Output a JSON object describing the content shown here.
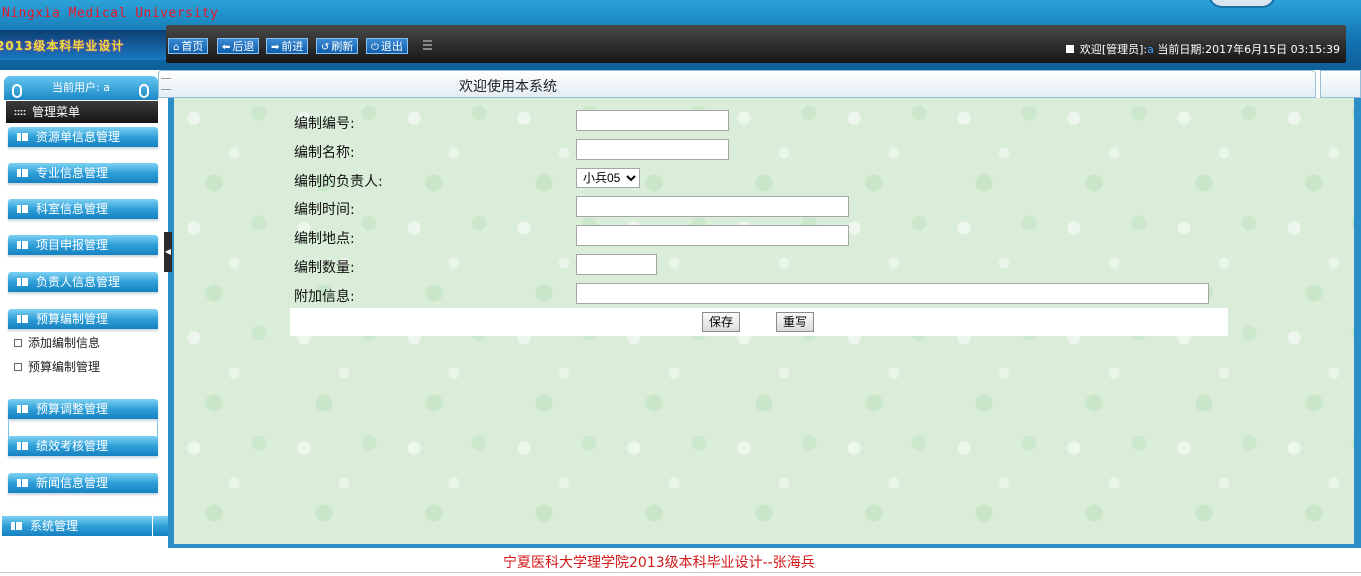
{
  "header": {
    "brand": "Ningxia Medical University",
    "banner_text": "2013级本科毕业设计",
    "toolbar": [
      {
        "icon": "home-icon",
        "glyph": "⌂",
        "label": "首页"
      },
      {
        "icon": "back-arrow-icon",
        "glyph": "⬅",
        "label": "后退"
      },
      {
        "icon": "forward-arrow-icon",
        "glyph": "➡",
        "label": "前进"
      },
      {
        "icon": "refresh-icon",
        "glyph": "↺",
        "label": "刷新"
      },
      {
        "icon": "power-icon",
        "glyph": "⏻",
        "label": "退出"
      }
    ],
    "welcome_prefix": "欢迎[管理员]:",
    "welcome_user": "a",
    "date_label": "当前日期:",
    "date_value": "2017年6月15日 03:15:39"
  },
  "sidebar": {
    "current_user": "当前用户: a",
    "menu_title": "管理菜单",
    "items": [
      {
        "label": "资源单信息管理"
      },
      {
        "label": "专业信息管理"
      },
      {
        "label": "科室信息管理"
      },
      {
        "label": "项目申报管理"
      },
      {
        "label": "负责人信息管理"
      },
      {
        "label": "预算编制管理"
      },
      {
        "label": "预算调整管理"
      },
      {
        "label": "绩效考核管理"
      },
      {
        "label": "新闻信息管理"
      }
    ],
    "subitems": [
      {
        "label": "添加编制信息"
      },
      {
        "label": "预算编制管理"
      }
    ],
    "system": {
      "label": "系统管理"
    }
  },
  "main": {
    "welcome_title": "欢迎使用本系统",
    "form": {
      "code_label": "编制编号:",
      "code_value": "",
      "name_label": "编制名称:",
      "name_value": "",
      "owner_label": "编制的负责人:",
      "owner_selected": "小兵05",
      "time_label": "编制时间:",
      "time_value": "",
      "place_label": "编制地点:",
      "place_value": "",
      "qty_label": "编制数量:",
      "qty_value": "",
      "extra_label": "附加信息:",
      "extra_value": "",
      "save_label": "保存",
      "reset_label": "重写"
    }
  },
  "footer": {
    "copyright": "宁夏医科大学理学院2013级本科毕业设计--张海兵"
  },
  "colors": {
    "header_blue": "#1474b3",
    "menu_blue": "#2f9fd8",
    "footer_red": "#d31818",
    "content_bg": "#d9edd8"
  }
}
